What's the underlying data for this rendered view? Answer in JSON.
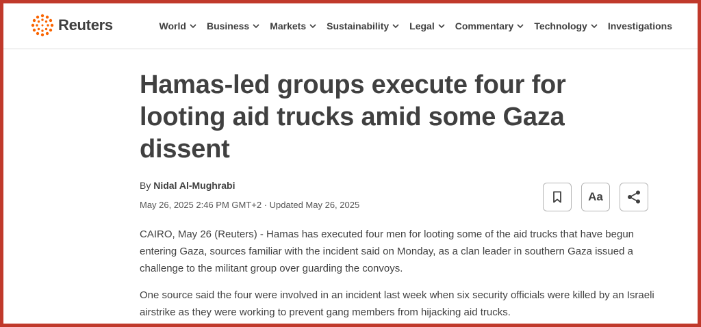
{
  "header": {
    "logo_text": "Reuters",
    "brand_color": "#fa6400",
    "nav": [
      {
        "label": "World",
        "has_dropdown": true
      },
      {
        "label": "Business",
        "has_dropdown": true
      },
      {
        "label": "Markets",
        "has_dropdown": true
      },
      {
        "label": "Sustainability",
        "has_dropdown": true
      },
      {
        "label": "Legal",
        "has_dropdown": true
      },
      {
        "label": "Commentary",
        "has_dropdown": true
      },
      {
        "label": "Technology",
        "has_dropdown": true
      },
      {
        "label": "Investigations",
        "has_dropdown": false
      }
    ]
  },
  "article": {
    "headline": "Hamas-led groups execute four for looting aid trucks amid some Gaza dissent",
    "byline_prefix": "By",
    "author": "Nidal Al-Mughrabi",
    "dateline": "May 26, 2025 2:46 PM GMT+2 · Updated May 26, 2025",
    "tools": {
      "bookmark_icon": "bookmark-icon",
      "text_size_label": "Aa",
      "share_icon": "share-icon"
    },
    "paragraphs": [
      "CAIRO, May 26 (Reuters) - Hamas has executed four men for looting some of the aid trucks that have begun entering Gaza, sources familiar with the incident said on Monday, as a clan leader in southern Gaza issued a challenge to the militant group over guarding the convoys.",
      "One source said the four were involved in an incident last week when six security officials were killed by an Israeli airstrike as they were working to prevent gang members from hijacking aid trucks."
    ]
  },
  "frame_color": "#c0392b"
}
